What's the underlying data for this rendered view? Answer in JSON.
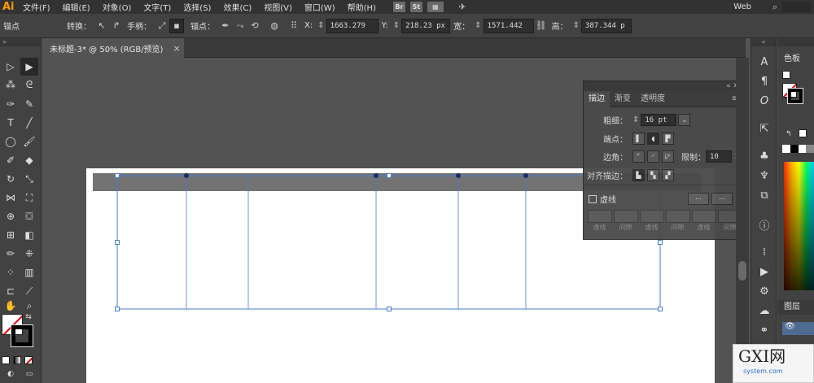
{
  "app": {
    "logo": "Ai"
  },
  "menu": [
    "文件(F)",
    "编辑(E)",
    "对象(O)",
    "文字(T)",
    "选择(S)",
    "效果(C)",
    "视图(V)",
    "窗口(W)",
    "帮助(H)"
  ],
  "bridge_icons": [
    "Br",
    "St"
  ],
  "workspace": "Web",
  "control_bar": {
    "selection_label": "锚点",
    "convert_label": "转换：",
    "handles_label": "手柄：",
    "anchors_label": "锚点：",
    "x_label": "X:",
    "x_value": "1663.279",
    "y_label": "Y:",
    "y_value": "218.23 px",
    "w_label": "宽：",
    "w_value": "1571.442",
    "h_label": "高：",
    "h_value": "387.344 p"
  },
  "document_tab": {
    "title": "未标题-3* @ 50% (RGB/预览)",
    "close": "×"
  },
  "stroke_panel": {
    "tabs": [
      "描边",
      "渐变",
      "透明度"
    ],
    "weight_label": "粗细：",
    "weight_value": "16 pt",
    "cap_label": "端点：",
    "corner_label": "边角：",
    "limit_label": "限制：",
    "limit_value": "10",
    "limit_unit": "x",
    "align_label": "对齐描边：",
    "dashed_label": "虚线",
    "dash_fields": [
      "虚线",
      "间隙",
      "虚线",
      "间隙",
      "虚线",
      "间隙"
    ]
  },
  "right_panel": {
    "color_title": "色板",
    "layers_title": "图层"
  },
  "watermark": {
    "text": "GXI网",
    "sub": "system.com"
  },
  "colors": {
    "accent": "#ff9a00",
    "selection": "#4a7bd6"
  }
}
